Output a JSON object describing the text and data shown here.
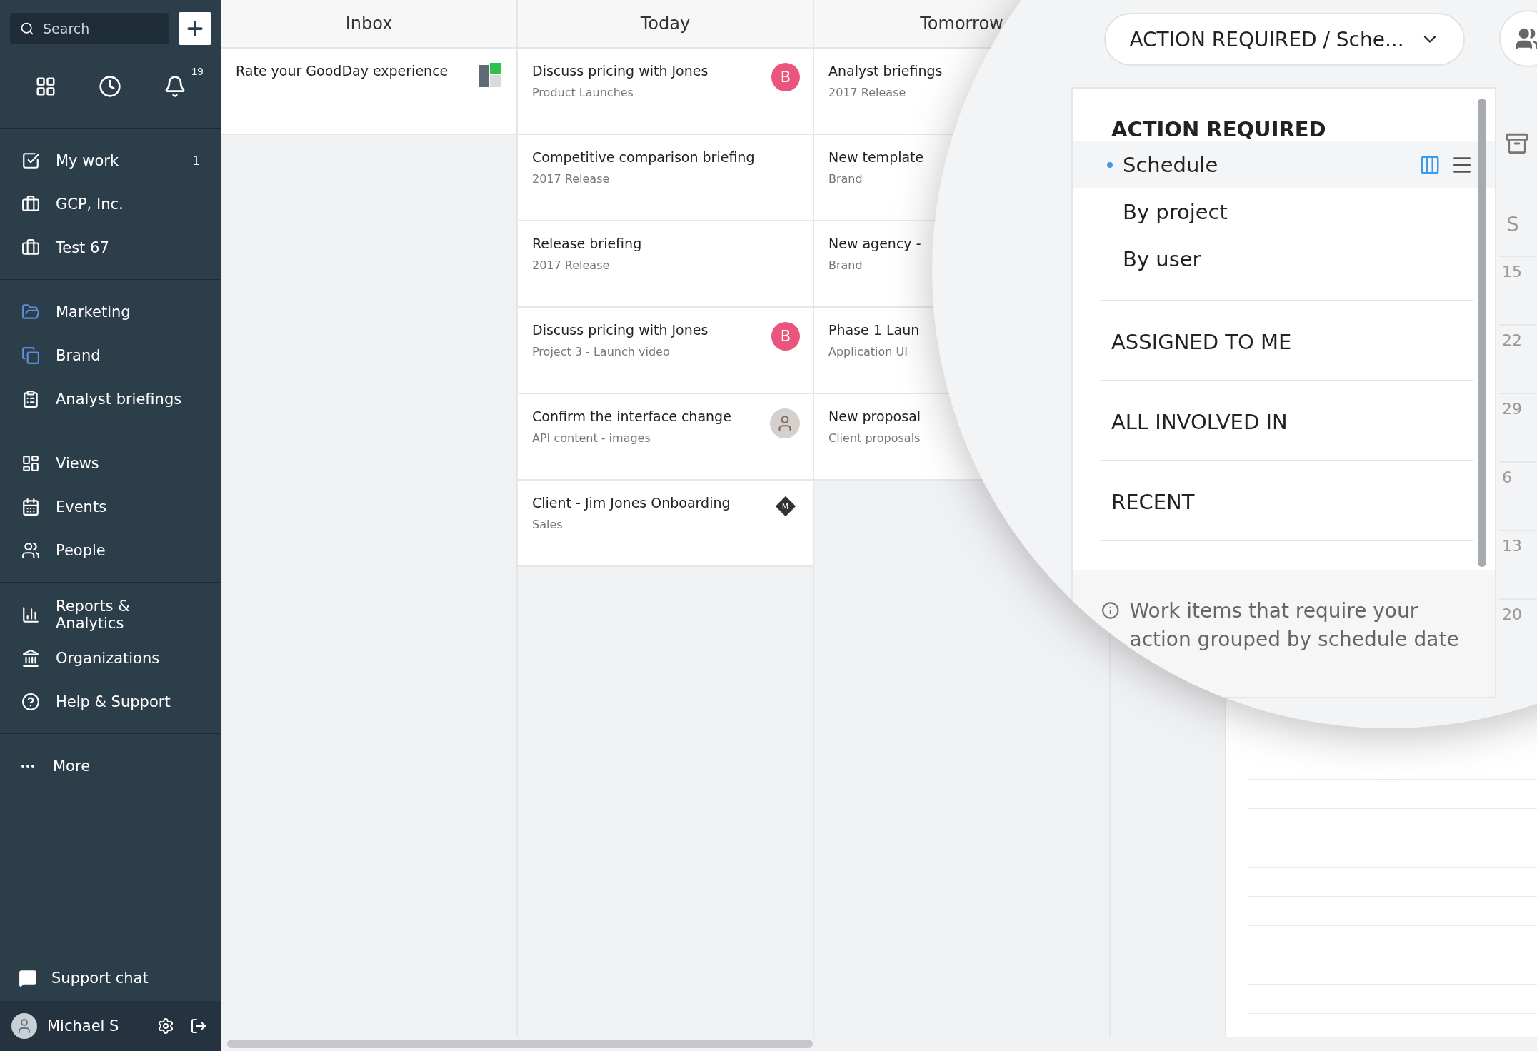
{
  "sidebar": {
    "search": {
      "placeholder": "Search"
    },
    "notifications": "19",
    "groups": [
      [
        {
          "kind": "check",
          "label": "My work",
          "count": "1",
          "color": "#ffffff"
        },
        {
          "kind": "briefcase",
          "label": "GCP, Inc.",
          "color": "#ffffff"
        },
        {
          "kind": "briefcase",
          "label": "Test 67",
          "color": "#ffffff"
        }
      ],
      [
        {
          "kind": "folder",
          "label": "Marketing",
          "color": "#5b8fd9"
        },
        {
          "kind": "copy",
          "label": "Brand",
          "color": "#5b8fd9"
        },
        {
          "kind": "clipboard",
          "label": "Analyst briefings",
          "color": "#ffffff"
        }
      ],
      [
        {
          "kind": "views",
          "label": "Views",
          "color": "#ffffff"
        },
        {
          "kind": "calendar",
          "label": "Events",
          "color": "#ffffff"
        },
        {
          "kind": "people",
          "label": "People",
          "color": "#ffffff"
        }
      ],
      [
        {
          "kind": "chart",
          "label": "Reports & Analytics",
          "color": "#ffffff"
        },
        {
          "kind": "bank",
          "label": "Organizations",
          "color": "#ffffff"
        },
        {
          "kind": "help",
          "label": "Help & Support",
          "color": "#ffffff"
        }
      ]
    ],
    "more": "More",
    "support_chat": "Support chat",
    "user": "Michael S"
  },
  "board": {
    "columns": [
      {
        "title": "Inbox",
        "cards": [
          {
            "title": "Rate your GoodDay experience",
            "badge": {
              "kind": "logo"
            }
          }
        ]
      },
      {
        "title": "Today",
        "cards": [
          {
            "title": "Discuss pricing with Jones",
            "subtitle": "Product Launches",
            "badge": {
              "kind": "letter",
              "text": "B"
            }
          },
          {
            "title": "Competitive comparison briefing",
            "subtitle": "2017 Release"
          },
          {
            "title": "Release briefing",
            "subtitle": "2017 Release"
          },
          {
            "title": "Discuss pricing with Jones",
            "subtitle": "Project 3 - Launch video",
            "badge": {
              "kind": "letter",
              "text": "B"
            }
          },
          {
            "title": "Confirm the interface change",
            "subtitle": "API content - images",
            "badge": {
              "kind": "photo"
            }
          },
          {
            "title": "Client - Jim Jones Onboarding",
            "subtitle": "Sales",
            "badge": {
              "kind": "diamond",
              "text": "M"
            }
          }
        ]
      },
      {
        "title": "Tomorrow",
        "cards": [
          {
            "title": "Analyst briefings",
            "subtitle": "2017 Release"
          },
          {
            "title": "New template",
            "subtitle": "Brand"
          },
          {
            "title": "New agency -",
            "subtitle": "Brand"
          },
          {
            "title": "Phase 1 Laun",
            "subtitle": "Application UI"
          },
          {
            "title": "New proposal",
            "subtitle": "Client proposals"
          }
        ]
      }
    ]
  },
  "view_menu": {
    "button": "ACTION REQUIRED / Sche...",
    "sections": [
      {
        "title": "ACTION REQUIRED",
        "items": [
          {
            "label": "Schedule",
            "selected": true
          },
          {
            "label": "By project",
            "selected": false
          },
          {
            "label": "By user",
            "selected": false
          }
        ]
      },
      {
        "title": "ASSIGNED TO ME"
      },
      {
        "title": "ALL INVOLVED IN"
      },
      {
        "title": "RECENT"
      }
    ],
    "description": "Work items that require your action grouped by schedule date"
  },
  "calendar": {
    "header": "S",
    "days": [
      "15",
      "22",
      "29",
      "6",
      "13",
      "20"
    ]
  }
}
